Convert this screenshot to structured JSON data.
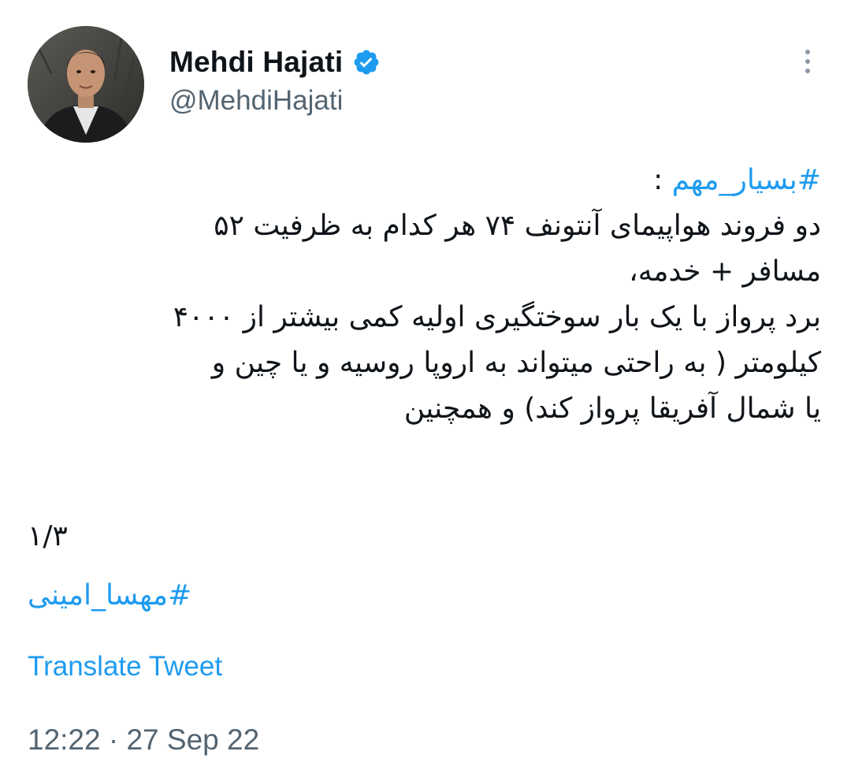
{
  "author": {
    "display_name": "Mehdi Hajati",
    "handle": "@MehdiHajati",
    "verified": true,
    "verified_icon": "verified-badge-icon"
  },
  "tweet": {
    "hashtag_top": "#بسیار_مهم",
    "hashtag_top_suffix": " :",
    "lines": [
      "دو فروند هواپیمای آنتونف ۷۴ هر کدام به ظرفیت  ۵۲",
      "مسافر + خدمه،",
      "برد پرواز با یک بار سوختگیری اولیه کمی بیشتر از ۴۰۰۰",
      "کیلومتر ( به راحتی میتواند به اروپا روسیه و یا چین و",
      "یا شمال آفریقا پرواز کند) و همچنین"
    ],
    "thread_count": "۱/۳",
    "hashtag_bottom": "#مهسا_امینی"
  },
  "actions": {
    "translate_label": "Translate Tweet",
    "more_icon": "more-options-icon"
  },
  "meta": {
    "timestamp": "12:22 · 27 Sep 22"
  },
  "colors": {
    "text": "#0f1419",
    "secondary": "#536471",
    "link": "#1d9bf0",
    "verified": "#1d9bf0"
  }
}
